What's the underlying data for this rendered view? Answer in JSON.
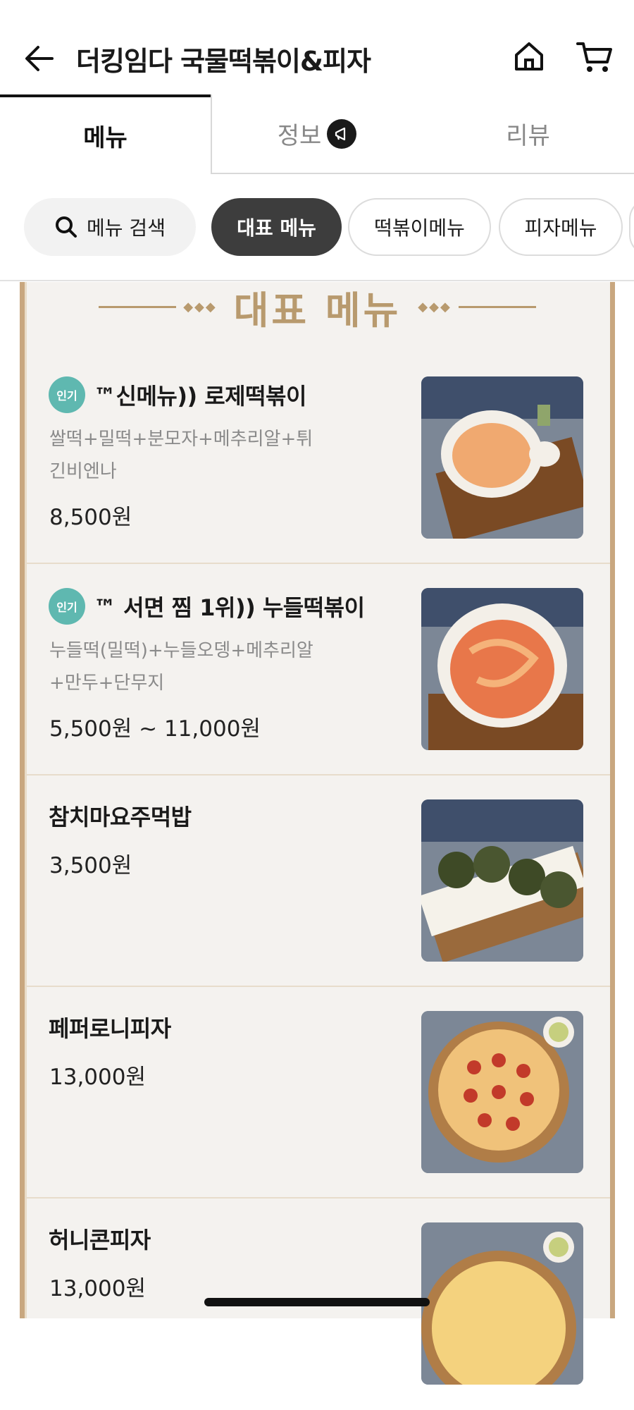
{
  "header": {
    "title": "더킹임다 국물떡볶이&피자"
  },
  "tabs": [
    {
      "label": "메뉴"
    },
    {
      "label": "정보"
    },
    {
      "label": "리뷰"
    }
  ],
  "chips": {
    "search": "메뉴 검색",
    "items": [
      "대표 메뉴",
      "떡볶이메뉴",
      "피자메뉴"
    ]
  },
  "section": {
    "title": "대표 메뉴"
  },
  "menu_items": [
    {
      "badge": "인기",
      "name": "™신메뉴)) 로제떡볶이",
      "desc": "쌀떡+밀떡+분모자+메추리알+튀긴비엔나",
      "price": "8,500원"
    },
    {
      "badge": "인기",
      "name": "™ 서면 찜 1위)) 누들떡볶이",
      "desc": "누들떡(밀떡)+누들오뎅+메추리알+만두+단무지",
      "price": "5,500원 ~ 11,000원"
    },
    {
      "name": "참치마요주먹밥",
      "price": "3,500원"
    },
    {
      "name": "페퍼로니피자",
      "price": "13,000원"
    },
    {
      "name": "허니콘피자",
      "price": "13,000원"
    }
  ],
  "colors": {
    "accent_gold": "#b89a6e",
    "badge_teal": "#5fb8b0",
    "chip_active": "#3d3d3d"
  },
  "icons": [
    "arrow-left-icon",
    "home-icon",
    "cart-icon",
    "megaphone-icon",
    "search-icon"
  ]
}
